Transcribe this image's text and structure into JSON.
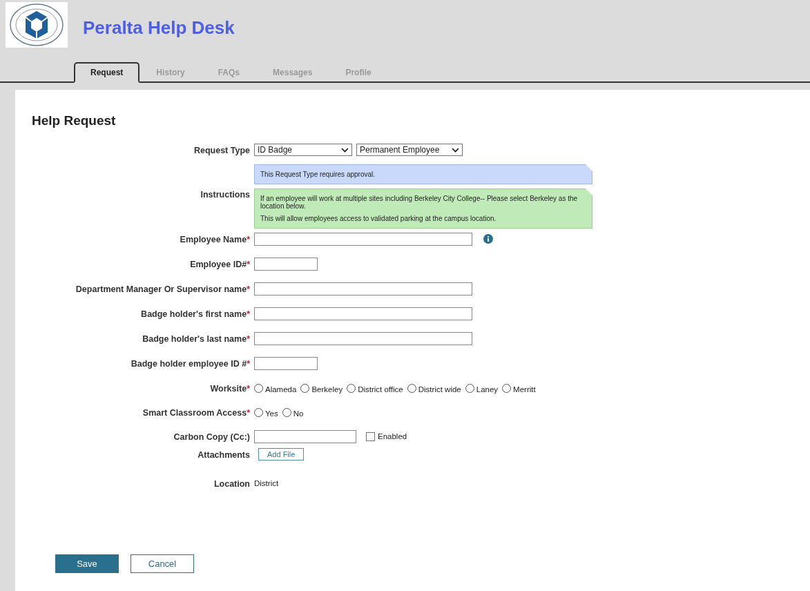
{
  "header": {
    "title": "Peralta Help Desk"
  },
  "tabs": [
    {
      "label": "Request",
      "selected": true
    },
    {
      "label": "History",
      "selected": false
    },
    {
      "label": "FAQs",
      "selected": false
    },
    {
      "label": "Messages",
      "selected": false
    },
    {
      "label": "Profile",
      "selected": false
    }
  ],
  "form": {
    "title": "Help Request",
    "rows": [
      {
        "kind": "selects",
        "label": "Request Type",
        "selects": [
          "ID Badge",
          "Permanent Employee"
        ]
      },
      {
        "kind": "instructions",
        "label": "Instructions",
        "notes": [
          {
            "kind": "info",
            "paragraphs": [
              "This Request Type requires approval."
            ]
          },
          {
            "kind": "success",
            "paragraphs": [
              "If an employee will work at multiple sites including Berkeley City College-- Please select Berkeley as the location below.",
              "This will allow employees access to validated parking at the campus location."
            ]
          }
        ]
      },
      {
        "kind": "text_info",
        "label": "Employee Name",
        "mark": "*"
      },
      {
        "kind": "short_text",
        "label": "Employee ID#",
        "mark": "*"
      },
      {
        "kind": "text",
        "label": "Department Manager Or Supervisor name",
        "mark": "*"
      },
      {
        "kind": "text",
        "label": "Badge holder's first name",
        "mark": "*"
      },
      {
        "kind": "text",
        "label": "Badge holder's last name",
        "mark": "*"
      },
      {
        "kind": "short_text",
        "label": "Badge holder employee ID #",
        "mark": "*"
      },
      {
        "kind": "radios",
        "label": "Worksite",
        "mark": "*",
        "options": [
          {
            "label": "Alameda",
            "selected": false
          },
          {
            "label": "Berkeley",
            "selected": false
          },
          {
            "label": "District office",
            "selected": false
          },
          {
            "label": "District wide",
            "selected": false
          },
          {
            "label": "Laney",
            "selected": false
          },
          {
            "label": "Merritt",
            "selected": false
          }
        ]
      },
      {
        "kind": "radios",
        "label": "Smart Classroom Access",
        "mark": "*",
        "options": [
          {
            "label": "Yes",
            "selected": false
          },
          {
            "label": "No",
            "selected": false
          }
        ]
      },
      {
        "kind": "cc",
        "label": "Carbon Copy (Cc:)",
        "checkbox": {
          "label": "Enabled",
          "checked": false
        }
      },
      {
        "kind": "attach",
        "label": "Attachments",
        "button": "Add File"
      },
      {
        "kind": "static",
        "label": "Location",
        "value": "District"
      }
    ]
  },
  "buttons": [
    {
      "label": "Save",
      "kind": "primary"
    },
    {
      "label": "Cancel",
      "kind": "secondary"
    }
  ]
}
